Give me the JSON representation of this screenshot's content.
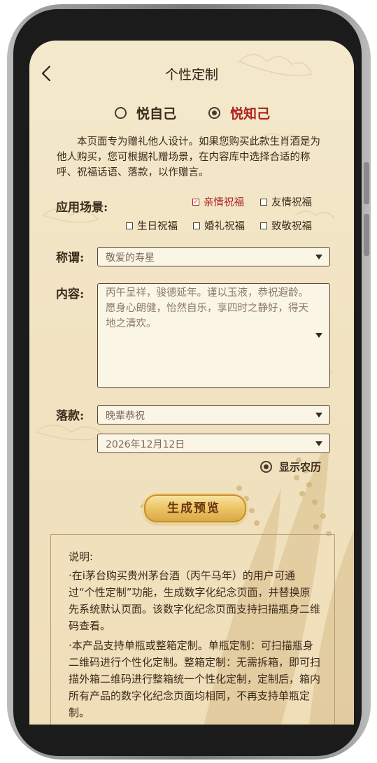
{
  "nav": {
    "title": "个性定制"
  },
  "recipient": {
    "options": [
      {
        "label": "悦自己",
        "selected": false
      },
      {
        "label": "悦知己",
        "selected": true
      }
    ]
  },
  "intro": "本页面专为赠礼他人设计。如果您购买此款生肖酒是为他人购买，您可根据礼赠场景，在内容库中选择合适的称呼、祝福话语、落款，以作赠言。",
  "scenario": {
    "label": "应用场景:",
    "options": [
      {
        "label": "亲情祝福",
        "checked": true
      },
      {
        "label": "友情祝福",
        "checked": false
      },
      {
        "label": "生日祝福",
        "checked": false
      },
      {
        "label": "婚礼祝福",
        "checked": false
      },
      {
        "label": "致敬祝福",
        "checked": false
      }
    ]
  },
  "salutation": {
    "label": "称谓:",
    "value": "敬爱的寿星"
  },
  "content": {
    "label": "内容:",
    "value": "丙午呈祥，骏德延年。谨以玉液，恭祝遐龄。愿身心朗健，怡然自乐，享四时之静好，得天地之清欢。"
  },
  "signature": {
    "label": "落款:",
    "value": "晚辈恭祝",
    "date": "2026年12月12日"
  },
  "lunar": {
    "label": "显示农历",
    "selected": true
  },
  "generate_button": "生成预览",
  "notes": {
    "heading": "说明:",
    "paragraphs": [
      "·在i茅台购买贵州茅台酒（丙午马年）的用户可通过“个性定制”功能，生成数字化纪念页面，并替换原先系统默认页面。该数字化纪念页面支持扫描瓶身二维码查看。",
      "·本产品支持单瓶或整箱定制。单瓶定制：可扫描瓶身二维码进行个性化定制。整箱定制：无需拆箱，即可扫描外箱二维码进行整箱统一个性化定制，定制后，箱内所有产品的数字化纪念页面均相同，不再支持单瓶定制。"
    ]
  },
  "colors": {
    "accent_red": "#b02020",
    "gold": "#ecc463",
    "paper": "#f4e9cd"
  }
}
